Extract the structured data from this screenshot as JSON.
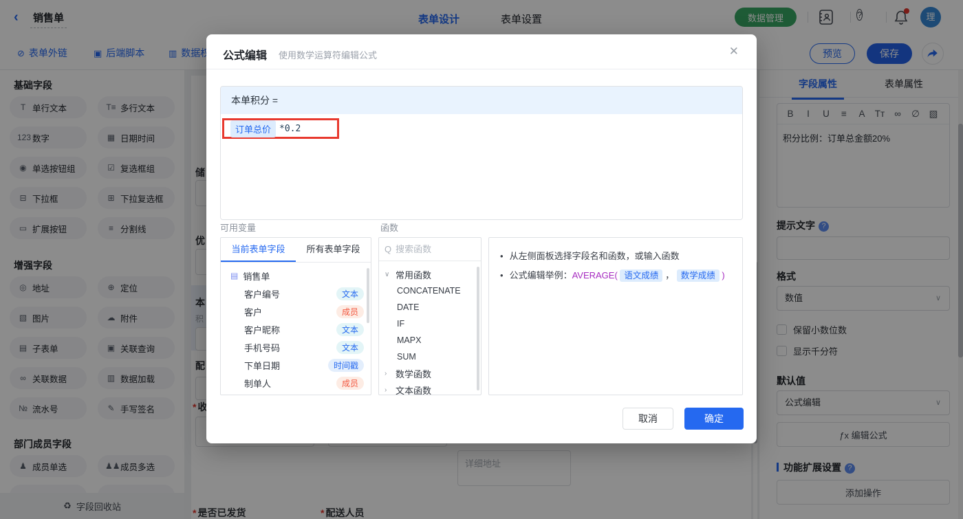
{
  "header": {
    "title": "销售单",
    "tabs": [
      {
        "label": "表单设计"
      },
      {
        "label": "表单设置"
      }
    ],
    "data_manage_label": "数据管理",
    "avatar_text": "理",
    "accent_blue": "#2569f0",
    "accent_green": "#38a763"
  },
  "toolbar": {
    "links": [
      {
        "glyph": "⊘",
        "label": "表单外链"
      },
      {
        "glyph": "▣",
        "label": "后端脚本"
      },
      {
        "glyph": "▥",
        "label": "数据权"
      }
    ],
    "preview_label": "预览",
    "save_label": "保存"
  },
  "left_sidebar": {
    "sections": [
      {
        "title": "基础字段",
        "items": [
          {
            "glyph": "T",
            "label": "单行文本"
          },
          {
            "glyph": "T≡",
            "label": "多行文本"
          },
          {
            "glyph": "123",
            "label": "数字"
          },
          {
            "glyph": "▦",
            "label": "日期时间"
          },
          {
            "glyph": "◉",
            "label": "单选按钮组"
          },
          {
            "glyph": "☑",
            "label": "复选框组"
          },
          {
            "glyph": "⊟",
            "label": "下拉框"
          },
          {
            "glyph": "⊞",
            "label": "下拉复选框"
          },
          {
            "glyph": "▭",
            "label": "扩展按钮"
          },
          {
            "glyph": "≡",
            "label": "分割线"
          }
        ]
      },
      {
        "title": "增强字段",
        "items": [
          {
            "glyph": "◎",
            "label": "地址"
          },
          {
            "glyph": "⊕",
            "label": "定位"
          },
          {
            "glyph": "▧",
            "label": "图片"
          },
          {
            "glyph": "☁",
            "label": "附件"
          },
          {
            "glyph": "▤",
            "label": "子表单"
          },
          {
            "glyph": "▣",
            "label": "关联查询"
          },
          {
            "glyph": "∞",
            "label": "关联数据"
          },
          {
            "glyph": "▥",
            "label": "数据加载"
          },
          {
            "glyph": "№",
            "label": "流水号"
          },
          {
            "glyph": "✎",
            "label": "手写签名"
          }
        ]
      },
      {
        "title": "部门成员字段",
        "items": [
          {
            "glyph": "♟",
            "label": "成员单选"
          },
          {
            "glyph": "♟♟",
            "label": "成员多选"
          }
        ]
      }
    ],
    "recycle_glyph": "♻",
    "recycle_label": "字段回收站"
  },
  "canvas": {
    "required_mark": "*",
    "field1_label": "储",
    "field2_label": "优",
    "selected_label": "本",
    "selected_sub": "积",
    "field4_label": "配",
    "field5_label": "收",
    "detail_placeholder": "详细地址",
    "shipped_label": "是否已发货",
    "courier_label": "配送人员"
  },
  "modal": {
    "title": "公式编辑",
    "subtitle": "使用数学运算符编辑公式",
    "close_glyph": "✕",
    "formula": {
      "target": "本单积分 =",
      "chip": "订单总价",
      "rest": "*0.2"
    },
    "variables": {
      "label": "可用变量",
      "tab_current": "当前表单字段",
      "tab_all": "所有表单字段",
      "root": "销售单",
      "fields": [
        {
          "name": "客户编号",
          "type": "文本",
          "badge_class": "badge badge-text"
        },
        {
          "name": "客户",
          "type": "成员",
          "badge_class": "badge badge-member"
        },
        {
          "name": "客户昵称",
          "type": "文本",
          "badge_class": "badge badge-text"
        },
        {
          "name": "手机号码",
          "type": "文本",
          "badge_class": "badge badge-text"
        },
        {
          "name": "下单日期",
          "type": "时间戳",
          "badge_class": "badge badge-time"
        },
        {
          "name": "制单人",
          "type": "成员",
          "badge_class": "badge badge-member"
        }
      ]
    },
    "functions": {
      "label": "函数",
      "search_placeholder": "搜索函数",
      "groups": [
        {
          "name": "常用函数",
          "expanded": true,
          "items": [
            "CONCATENATE",
            "DATE",
            "IF",
            "MAPX",
            "SUM"
          ]
        },
        {
          "name": "数学函数",
          "expanded": false
        },
        {
          "name": "文本函数",
          "expanded": false
        }
      ]
    },
    "help": {
      "line1": "从左侧面板选择字段名和函数，或输入函数",
      "line2_prefix": "公式编辑举例：",
      "fn_open": "AVERAGE(",
      "chip1": "语文成绩",
      "comma": "，",
      "chip2": "数学成绩",
      "fn_close": ")"
    },
    "cancel_label": "取消",
    "confirm_label": "确定"
  },
  "right_sidebar": {
    "tab_field": "字段属性",
    "tab_form": "表单属性",
    "richtext": {
      "tools": [
        "B",
        "I",
        "U",
        "≡",
        "A",
        "Tᴛ",
        "∞",
        "∅",
        "▧"
      ],
      "content": "积分比例：订单总金额20%"
    },
    "hint_label": "提示文字",
    "format_label": "格式",
    "format_value": "数值",
    "select_chevron": "∨",
    "checkbox1": "保留小数位数",
    "checkbox2": "显示千分符",
    "default_label": "默认值",
    "default_value": "公式编辑",
    "fx_glyph": "ƒx",
    "edit_formula_label": "编辑公式",
    "ext_label": "功能扩展设置",
    "add_action_label": "添加操作"
  }
}
